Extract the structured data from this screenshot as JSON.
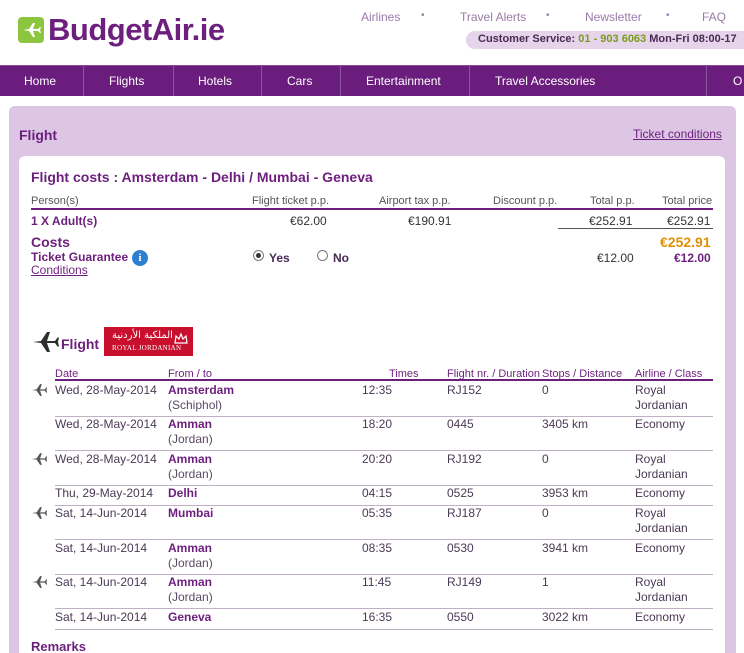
{
  "header": {
    "logo_text": "BudgetAir.ie",
    "top_links": [
      "Airlines",
      "Travel Alerts",
      "Newsletter",
      "FAQ"
    ],
    "separator": "•",
    "customer_service_label": "Customer Service:",
    "customer_service_phone": "01 - 903 6063",
    "customer_service_hours": "Mon-Fri 08:00-17"
  },
  "nav": {
    "items": [
      "Home",
      "Flights",
      "Hotels",
      "Cars",
      "Entertainment",
      "Travel Accessories",
      "O"
    ]
  },
  "page": {
    "title": "Flight",
    "ticket_conditions_link": "Ticket conditions"
  },
  "costs": {
    "title": "Flight costs : Amsterdam - Delhi / Mumbai - Geneva",
    "headers": {
      "persons": "Person(s)",
      "flight_ticket": "Flight ticket p.p.",
      "airport_tax": "Airport tax p.p.",
      "discount": "Discount p.p.",
      "total_pp": "Total p.p.",
      "total_price": "Total price"
    },
    "row": {
      "persons": "1 X Adult(s)",
      "flight_ticket": "€62.00",
      "airport_tax": "€190.91",
      "total_pp": "€252.91",
      "total_price": "€252.91"
    },
    "costs_label": "Costs",
    "costs_total": "€252.91",
    "guarantee_label": "Ticket Guarantee",
    "info_glyph": "i",
    "conditions_link": "Conditions",
    "yes_label": "Yes",
    "no_label": "No",
    "yes_checked": true,
    "guarantee_pp": "€12.00",
    "guarantee_total": "€12.00"
  },
  "flight": {
    "section_label": "Flight",
    "airline_logo_arabic": "الملكية الأردنية",
    "airline_logo_text": "ROYAL JORDANIAN",
    "headers": {
      "date": "Date",
      "from_to": "From / to",
      "times": "Times",
      "flight_nr": "Flight nr. / Duration",
      "stops": "Stops / Distance",
      "airline": "Airline / Class"
    },
    "rows": [
      {
        "icon": true,
        "date": "Wed, 28-May-2014",
        "dest": "Amsterdam",
        "sub": "(Schiphol)",
        "time": "12:35",
        "flight": "RJ152",
        "stops": "0",
        "airline": "Royal",
        "airline2": "Jordanian"
      },
      {
        "icon": false,
        "date": "Wed, 28-May-2014",
        "dest": "Amman",
        "sub": "(Jordan)",
        "time": "18:20",
        "flight": "0445",
        "stops": "3405 km",
        "airline": "Economy",
        "airline2": ""
      },
      {
        "icon": true,
        "date": "Wed, 28-May-2014",
        "dest": "Amman",
        "sub": "(Jordan)",
        "time": "20:20",
        "flight": "RJ192",
        "stops": "0",
        "airline": "Royal",
        "airline2": "Jordanian"
      },
      {
        "icon": false,
        "date": "Thu, 29-May-2014",
        "dest": "Delhi",
        "sub": "",
        "time": "04:15",
        "flight": "0525",
        "stops": "3953 km",
        "airline": "Economy",
        "airline2": ""
      },
      {
        "icon": true,
        "date": "Sat, 14-Jun-2014",
        "dest": "Mumbai",
        "sub": "",
        "time": "05:35",
        "flight": "RJ187",
        "stops": "0",
        "airline": "Royal",
        "airline2": "Jordanian"
      },
      {
        "icon": false,
        "date": "Sat, 14-Jun-2014",
        "dest": "Amman",
        "sub": "(Jordan)",
        "time": "08:35",
        "flight": "0530",
        "stops": "3941 km",
        "airline": "Economy",
        "airline2": ""
      },
      {
        "icon": true,
        "date": "Sat, 14-Jun-2014",
        "dest": "Amman",
        "sub": "(Jordan)",
        "time": "11:45",
        "flight": "RJ149",
        "stops": "1",
        "airline": "Royal",
        "airline2": "Jordanian"
      },
      {
        "icon": false,
        "date": "Sat, 14-Jun-2014",
        "dest": "Geneva",
        "sub": "",
        "time": "16:35",
        "flight": "0550",
        "stops": "3022 km",
        "airline": "Economy",
        "airline2": ""
      }
    ]
  },
  "remarks_label": "Remarks",
  "colors": {
    "brand_purple": "#6d1f7e",
    "brand_green": "#8cc63f",
    "total_orange": "#e0900a",
    "panel_lilac": "#dcc6e4"
  }
}
